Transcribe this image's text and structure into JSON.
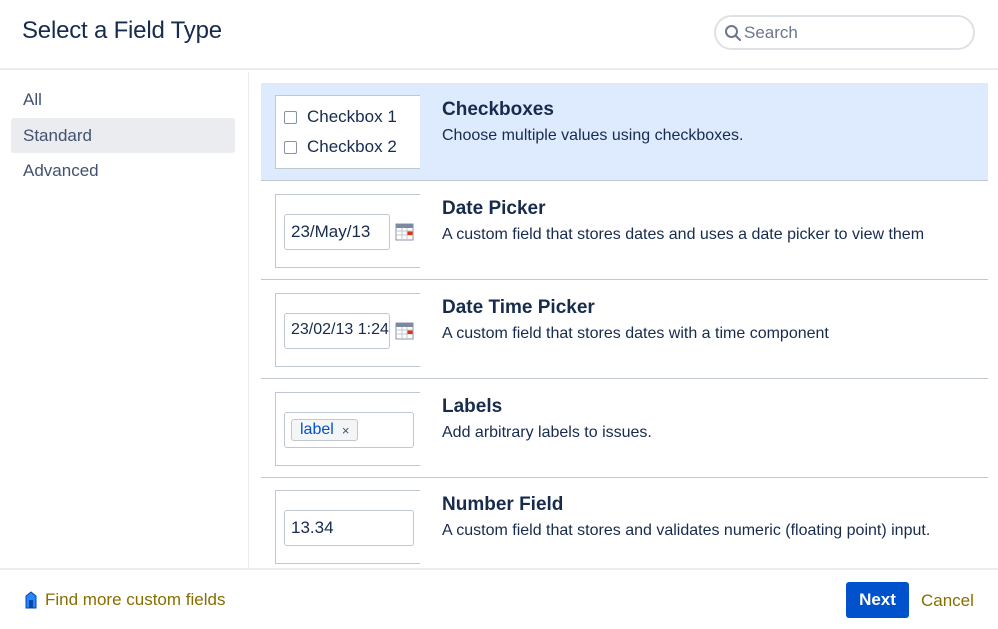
{
  "header": {
    "title": "Select a Field Type",
    "search_placeholder": "Search"
  },
  "sidebar": {
    "items": [
      {
        "label": "All",
        "active": false
      },
      {
        "label": "Standard",
        "active": true
      },
      {
        "label": "Advanced",
        "active": false
      }
    ]
  },
  "field_types": [
    {
      "title": "Checkboxes",
      "description": "Choose multiple values using checkboxes.",
      "preview": {
        "checkbox_1": "Checkbox 1",
        "checkbox_2": "Checkbox 2"
      },
      "selected": true
    },
    {
      "title": "Date Picker",
      "description": "A custom field that stores dates and uses a date picker to view them",
      "preview": {
        "value": "23/May/13"
      }
    },
    {
      "title": "Date Time Picker",
      "description": "A custom field that stores dates with a time component",
      "preview": {
        "value": "23/02/13 1:24"
      }
    },
    {
      "title": "Labels",
      "description": "Add arbitrary labels to issues.",
      "preview": {
        "chip": "label",
        "remove": "×"
      }
    },
    {
      "title": "Number Field",
      "description": "A custom field that stores and validates numeric (floating point) input.",
      "preview": {
        "value": "13.34"
      }
    }
  ],
  "footer": {
    "find_link": "Find more custom fields",
    "next_label": "Next",
    "cancel_label": "Cancel"
  },
  "colors": {
    "accent": "#0052cc",
    "selected_row": "#deebff",
    "link": "#8a6d00",
    "text": "#172b4d"
  },
  "icons": [
    "search-icon",
    "calendar-icon",
    "marketplace-icon"
  ]
}
